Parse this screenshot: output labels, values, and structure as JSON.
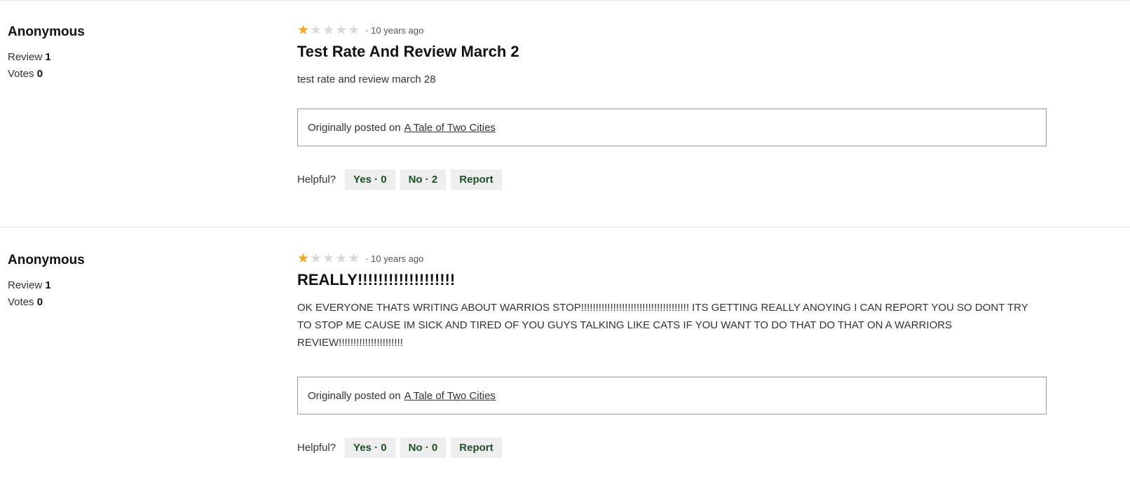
{
  "reviews": [
    {
      "author": "Anonymous",
      "review_label": "Review",
      "review_count": "1",
      "votes_label": "Votes",
      "votes_count": "0",
      "rating": 1,
      "rating_max": 5,
      "time": "· 10 years ago",
      "title": "Test Rate And Review March 2",
      "body": "test rate and review march 28",
      "posted_prefix": "Originally posted on",
      "posted_link": "A Tale of Two Cities",
      "helpful_label": "Helpful?",
      "yes_label": "Yes · 0",
      "no_label": "No · 2",
      "report_label": "Report"
    },
    {
      "author": "Anonymous",
      "review_label": "Review",
      "review_count": "1",
      "votes_label": "Votes",
      "votes_count": "0",
      "rating": 1,
      "rating_max": 5,
      "time": "· 10 years ago",
      "title": "REALLY!!!!!!!!!!!!!!!!!!!",
      "body": "OK EVERYONE THATS WRITING ABOUT WARRIOS STOP!!!!!!!!!!!!!!!!!!!!!!!!!!!!!!!!!!!!! ITS GETTING REALLY ANOYING I CAN REPORT YOU SO DONT TRY TO STOP ME CAUSE IM SICK AND TIRED OF YOU GUYS TALKING LIKE CATS IF YOU WANT TO DO THAT DO THAT ON A WARRIORS REVIEW!!!!!!!!!!!!!!!!!!!!!!",
      "posted_prefix": "Originally posted on",
      "posted_link": "A Tale of Two Cities",
      "helpful_label": "Helpful?",
      "yes_label": "Yes · 0",
      "no_label": "No · 0",
      "report_label": "Report"
    }
  ],
  "colors": {
    "star_filled": "#f5a623",
    "star_empty": "#d9d9d9",
    "button_text": "#1e4d2b",
    "button_bg": "#eeeeee"
  }
}
